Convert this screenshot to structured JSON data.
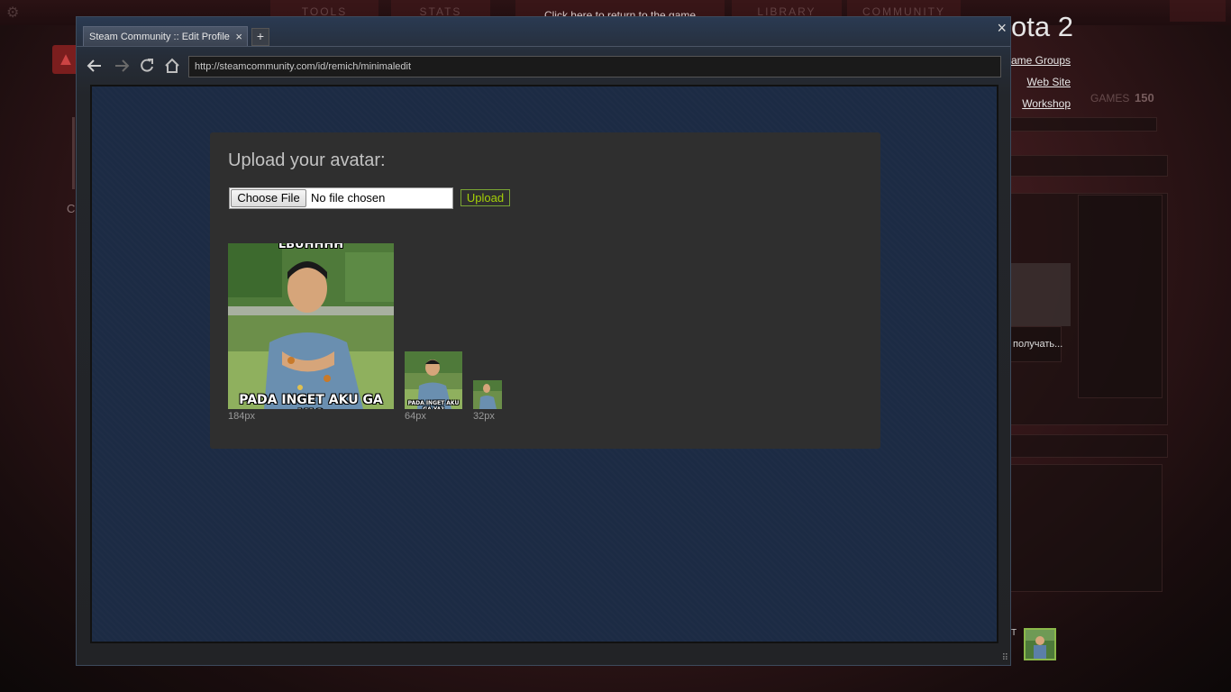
{
  "game_overlay": {
    "tabs": [
      "TOOLS",
      "STATS",
      "LIBRARY",
      "COMMUNITY"
    ],
    "return_text": "Click here to return to the game",
    "title_partial": "ota 2",
    "links": [
      "ame Groups",
      "Web Site",
      "Workshop"
    ],
    "games_label": "GAMES",
    "games_count": "150",
    "chat_partial": "получать...",
    "left_partial": "C",
    "user_partial": "T"
  },
  "browser": {
    "tab_title": "Steam Community :: Edit Profile",
    "tab_close": "×",
    "new_tab": "+",
    "close": "×",
    "url": "http://steamcommunity.com/id/remich/minimaledit"
  },
  "upload": {
    "title": "Upload your avatar:",
    "choose_file_label": "Choose File",
    "file_status": "No file chosen",
    "upload_label": "Upload",
    "avatars": [
      {
        "label": "184px",
        "caption": "PADA INGET AKU GA YA?",
        "top_caption": "LBUHHHH"
      },
      {
        "label": "64px",
        "caption": "PADA INGET AKU GA YA?"
      },
      {
        "label": "32px"
      }
    ]
  },
  "colors": {
    "accent_green": "#a4d007",
    "page_bg": "#1c2b44",
    "panel_bg": "#2f2f2f"
  }
}
